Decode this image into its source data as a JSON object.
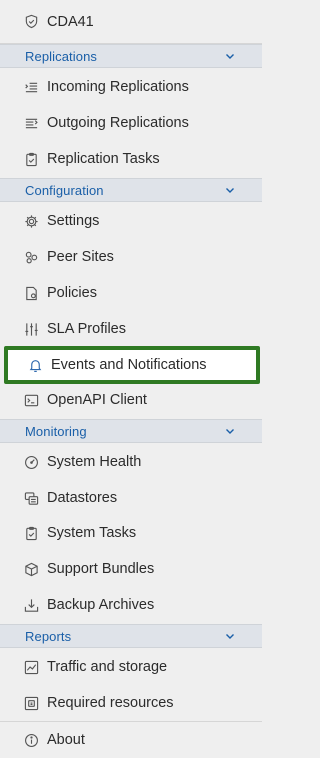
{
  "site": {
    "name": "CDA41",
    "icon": "shield-icon"
  },
  "sections": [
    {
      "title": "Replications",
      "items": [
        {
          "label": "Incoming Replications",
          "icon": "incoming-list-icon"
        },
        {
          "label": "Outgoing Replications",
          "icon": "outgoing-list-icon"
        },
        {
          "label": "Replication Tasks",
          "icon": "clipboard-check-icon"
        }
      ]
    },
    {
      "title": "Configuration",
      "items": [
        {
          "label": "Settings",
          "icon": "gear-icon"
        },
        {
          "label": "Peer Sites",
          "icon": "peer-sites-icon"
        },
        {
          "label": "Policies",
          "icon": "policy-document-icon"
        },
        {
          "label": "SLA Profiles",
          "icon": "sliders-icon"
        },
        {
          "label": "Events and Notifications",
          "icon": "bell-icon",
          "selected": true
        },
        {
          "label": "OpenAPI Client",
          "icon": "terminal-icon"
        }
      ]
    },
    {
      "title": "Monitoring",
      "items": [
        {
          "label": "System Health",
          "icon": "gauge-icon"
        },
        {
          "label": "Datastores",
          "icon": "datastores-icon"
        },
        {
          "label": "System Tasks",
          "icon": "clipboard-check-icon"
        },
        {
          "label": "Support Bundles",
          "icon": "cube-icon"
        },
        {
          "label": "Backup Archives",
          "icon": "download-tray-icon"
        }
      ]
    },
    {
      "title": "Reports",
      "items": [
        {
          "label": "Traffic and storage",
          "icon": "line-chart-icon"
        },
        {
          "label": "Required resources",
          "icon": "resource-box-icon"
        }
      ]
    }
  ],
  "footer": {
    "label": "About",
    "icon": "info-icon"
  },
  "colors": {
    "background": "#efefef",
    "section_header_bg": "#dfe3e9",
    "section_header_text": "#1a5fa8",
    "selected_border": "#2f7a23",
    "selected_bg": "#ffffff"
  }
}
